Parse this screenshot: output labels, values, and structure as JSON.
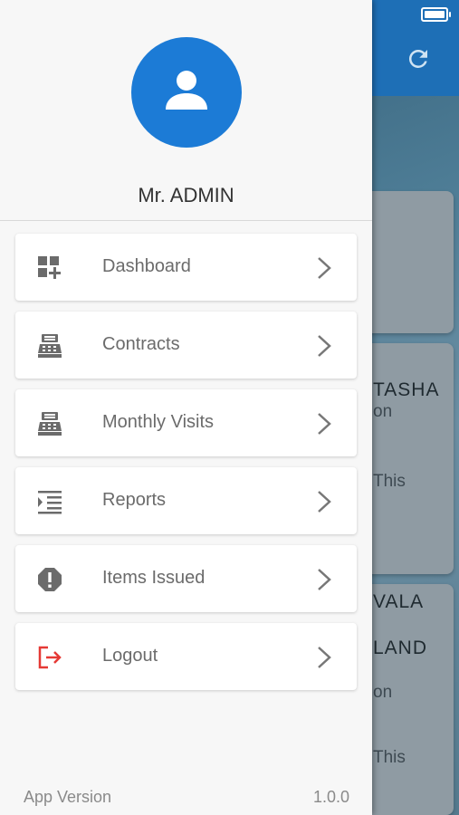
{
  "profile": {
    "name": "Mr. ADMIN"
  },
  "menu": {
    "items": [
      {
        "label": "Dashboard",
        "icon": "dashboard-icon"
      },
      {
        "label": "Contracts",
        "icon": "cash-register-icon"
      },
      {
        "label": "Monthly Visits",
        "icon": "cash-register-icon"
      },
      {
        "label": "Reports",
        "icon": "indent-list-icon"
      },
      {
        "label": "Items Issued",
        "icon": "alert-octagon-icon"
      },
      {
        "label": "Logout",
        "icon": "logout-icon"
      }
    ]
  },
  "footer": {
    "label": "App Version",
    "value": "1.0.0"
  },
  "background": {
    "card1_title": "TASHA",
    "card1_line2": "on",
    "card1_line3": "This",
    "card2_title": "VALA",
    "card2_line2": "LAND",
    "card2_line3": "on",
    "card2_line4": "This"
  },
  "colors": {
    "accent": "#1c7bd6",
    "header": "#1e6fb6",
    "logout": "#e53935"
  }
}
